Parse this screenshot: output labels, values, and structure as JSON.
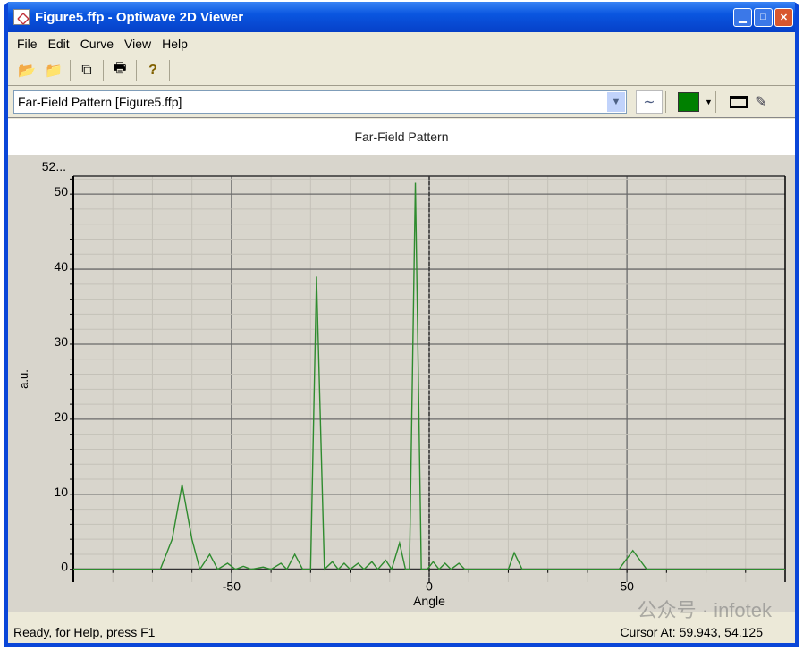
{
  "window": {
    "title": "Figure5.ffp - Optiwave 2D Viewer",
    "controls": [
      "minimize",
      "maximize",
      "close"
    ]
  },
  "menu": [
    "File",
    "Edit",
    "Curve",
    "View",
    "Help"
  ],
  "toolbar": {
    "icons": [
      "open-folder-icon",
      "add-folder-icon",
      "copy-icon",
      "print-icon",
      "help-icon"
    ]
  },
  "curve_selector": {
    "value": "Far-Field Pattern [Figure5.ffp]",
    "curve_color": "#008000"
  },
  "status": {
    "left": "Ready, for Help, press F1",
    "cursor": "Cursor At: 59.943, 54.125"
  },
  "watermark": "公众号 · infotek",
  "chart_data": {
    "type": "line",
    "title": "Far-Field Pattern",
    "xlabel": "Angle",
    "ylabel": "a.u.",
    "xlim": [
      -90,
      90
    ],
    "ylim": [
      -1.7,
      52.4
    ],
    "y_max_label": "52...",
    "xticks": [
      -50,
      0,
      50
    ],
    "yticks": [
      0,
      10,
      20,
      30,
      40,
      50
    ],
    "grid": true,
    "line_color": "#2e8b2e",
    "x": [
      -90,
      -68,
      -65,
      -62.5,
      -60,
      -58,
      -55.5,
      -53.5,
      -51,
      -49,
      -47,
      -45,
      -42,
      -40,
      -37.5,
      -36,
      -34,
      -32,
      -30,
      -28.5,
      -26.5,
      -24.5,
      -23,
      -21.5,
      -20,
      -18,
      -16.5,
      -14.5,
      -13,
      -11,
      -9.5,
      -7.5,
      -6,
      -5,
      -3.5,
      -2,
      -0.5,
      1,
      2.5,
      4,
      5.5,
      7.5,
      9,
      20,
      21.5,
      23.5,
      48,
      51.5,
      55,
      90
    ],
    "y": [
      0,
      0,
      4,
      11.3,
      4,
      0,
      2,
      0,
      0.8,
      0,
      0.4,
      0,
      0.3,
      0,
      0.8,
      0,
      2,
      0,
      0,
      39,
      0,
      1,
      0,
      0.8,
      0,
      0.8,
      0,
      1,
      0,
      1.2,
      0,
      3.5,
      0,
      0,
      51.5,
      0,
      0,
      1,
      0,
      0.8,
      0,
      0.8,
      0,
      0,
      2.2,
      0,
      0,
      2.5,
      0,
      0
    ]
  }
}
